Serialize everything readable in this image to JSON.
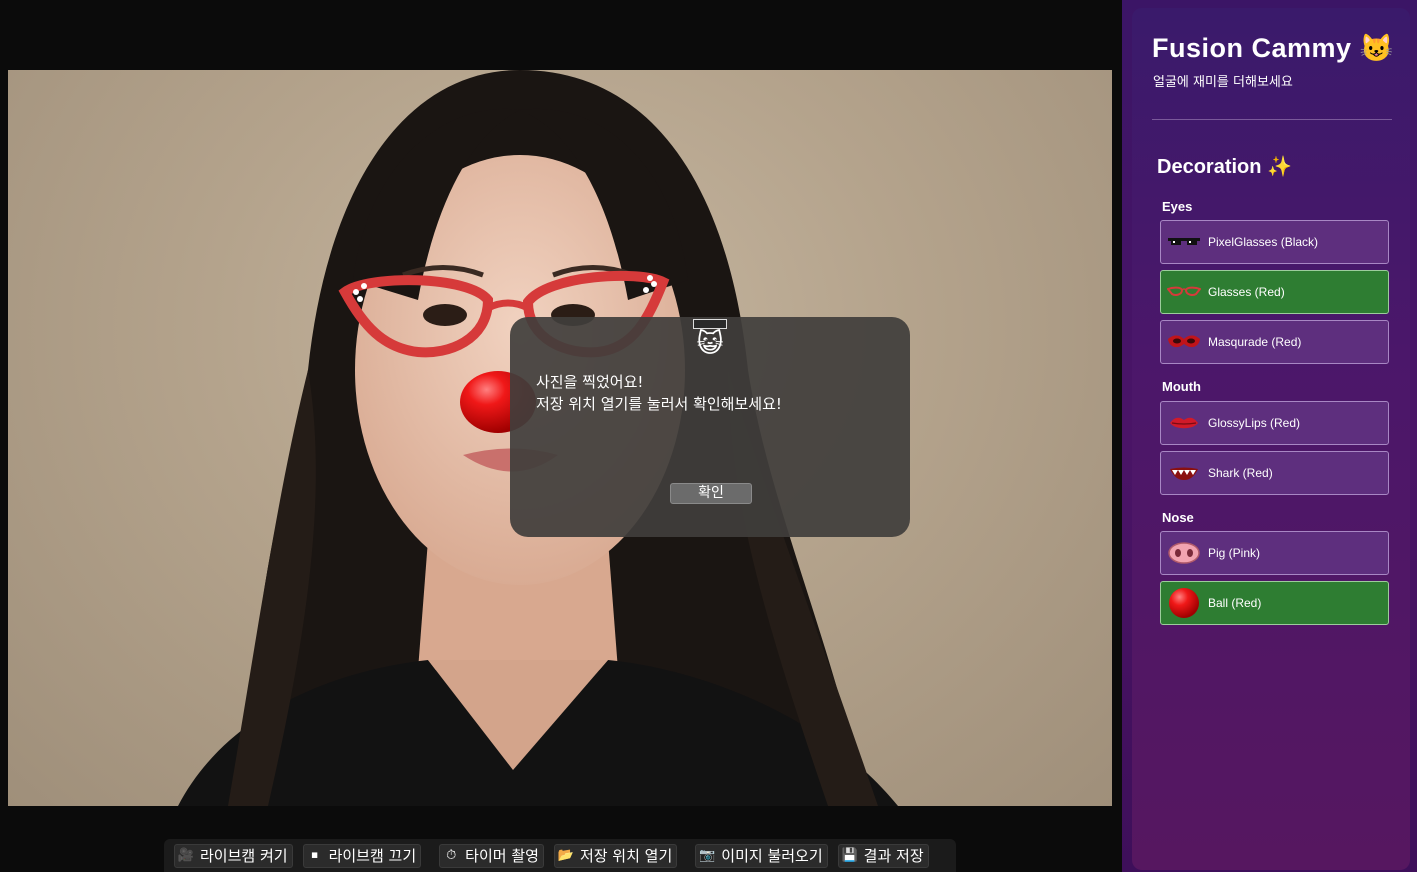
{
  "dialog": {
    "line1": "사진을 찍었어요!",
    "line2": "저장 위치 열기를 눌러서 확인해보세요!",
    "ok_label": "확인"
  },
  "toolbar": {
    "buttons": [
      {
        "label": "라이브캠 켜기",
        "icon": "camera-icon"
      },
      {
        "label": "라이브캠 끄기",
        "icon": "stop-icon"
      },
      {
        "label": "타이머 촬영",
        "icon": "timer-icon"
      },
      {
        "label": "저장 위치 열기",
        "icon": "folder-icon"
      },
      {
        "label": "이미지 불러오기",
        "icon": "image-icon"
      },
      {
        "label": "결과 저장",
        "icon": "save-icon"
      }
    ]
  },
  "panel": {
    "title": "Fusion Cammy",
    "subtitle": "얼굴에 재미를 더해보세요",
    "decoration_title": "Decoration",
    "sections": {
      "eyes": {
        "title": "Eyes",
        "items": [
          {
            "label": "PixelGlasses (Black)",
            "icon": "pixel-glasses-icon",
            "selected": false
          },
          {
            "label": "Glasses (Red)",
            "icon": "red-glasses-icon",
            "selected": true
          },
          {
            "label": "Masqurade (Red)",
            "icon": "mask-icon",
            "selected": false
          }
        ]
      },
      "mouth": {
        "title": "Mouth",
        "items": [
          {
            "label": "GlossyLips (Red)",
            "icon": "lips-icon",
            "selected": false
          },
          {
            "label": "Shark (Red)",
            "icon": "shark-teeth-icon",
            "selected": false
          }
        ]
      },
      "nose": {
        "title": "Nose",
        "items": [
          {
            "label": "Pig (Pink)",
            "icon": "pig-nose-icon",
            "selected": false
          },
          {
            "label": "Ball (Red)",
            "icon": "red-ball-icon",
            "selected": true
          }
        ]
      }
    }
  },
  "colors": {
    "selected_item": "#2e7d32",
    "item": "#5e2f7e",
    "panel": "#4a1466",
    "dialog": "#403e3c"
  }
}
